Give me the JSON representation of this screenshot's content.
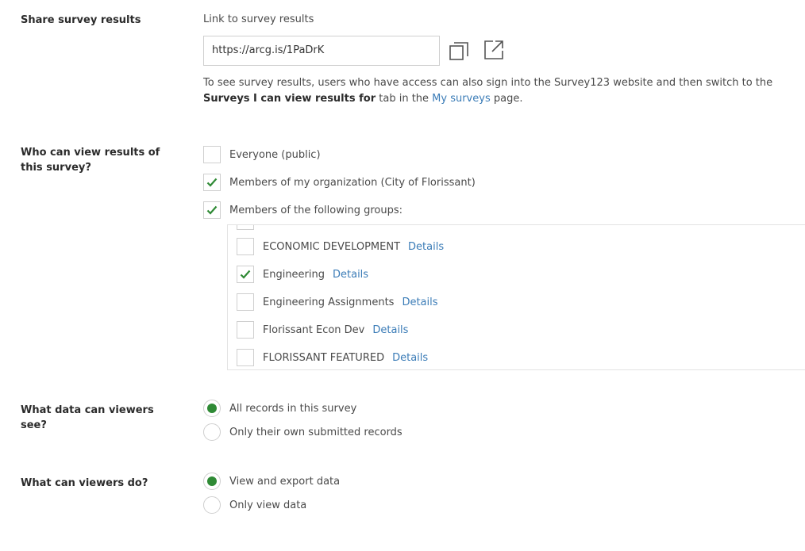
{
  "share": {
    "section_label": "Share survey results",
    "link_label": "Link to survey results",
    "url": "https://arcg.is/1PaDrK",
    "copy_icon": "copy-icon",
    "open_icon": "open-external-icon",
    "help_text_1": "To see survey results, users who have access can also sign into the Survey123 website and then switch to the ",
    "help_bold": "Surveys I can view results for",
    "help_text_2": " tab in the ",
    "help_link": "My surveys",
    "help_text_3": " page."
  },
  "who": {
    "section_label": "Who can view results of this survey?",
    "options": [
      {
        "label": "Everyone (public)",
        "checked": false
      },
      {
        "label": "Members of my organization (City of Florissant)",
        "checked": true
      },
      {
        "label": "Members of the following groups:",
        "checked": true
      }
    ],
    "groups": [
      {
        "name": "ECONOMIC DEVELOPMENT",
        "details": "Details",
        "checked": false
      },
      {
        "name": "Engineering",
        "details": "Details",
        "checked": true
      },
      {
        "name": "Engineering Assignments",
        "details": "Details",
        "checked": false
      },
      {
        "name": "Florissant Econ Dev",
        "details": "Details",
        "checked": false
      },
      {
        "name": "FLORISSANT FEATURED",
        "details": "Details",
        "checked": false
      }
    ]
  },
  "data_view": {
    "section_label": "What data can viewers see?",
    "options": [
      {
        "label": "All records in this survey",
        "selected": true
      },
      {
        "label": "Only their own submitted records",
        "selected": false
      }
    ]
  },
  "viewer_actions": {
    "section_label": "What can viewers do?",
    "options": [
      {
        "label": "View and export data",
        "selected": true
      },
      {
        "label": "Only view data",
        "selected": false
      }
    ]
  },
  "colors": {
    "check": "#2f8a35",
    "link": "#3b7cb7",
    "border": "#cfcfcf"
  }
}
